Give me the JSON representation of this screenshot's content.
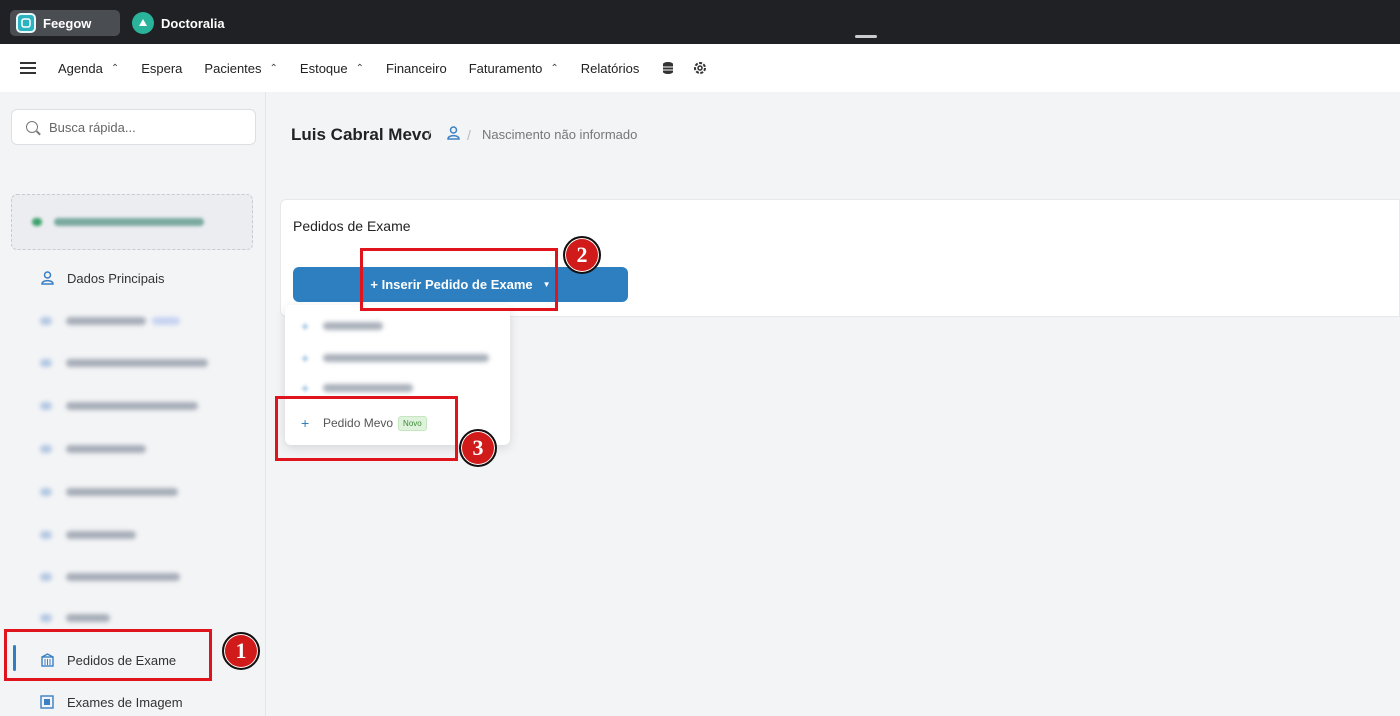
{
  "tabs": [
    {
      "label": "Feegow"
    },
    {
      "label": "Doctoralia"
    }
  ],
  "nav": {
    "items": [
      {
        "label": "Agenda",
        "has_dropdown": true
      },
      {
        "label": "Espera",
        "has_dropdown": false
      },
      {
        "label": "Pacientes",
        "has_dropdown": true
      },
      {
        "label": "Estoque",
        "has_dropdown": true
      },
      {
        "label": "Financeiro",
        "has_dropdown": false
      },
      {
        "label": "Faturamento",
        "has_dropdown": true
      },
      {
        "label": "Relatórios",
        "has_dropdown": false
      }
    ],
    "icons": [
      "menu-icon",
      "database-icon",
      "settings-icon"
    ]
  },
  "sidebar": {
    "search_placeholder": "Busca rápida...",
    "items": {
      "dados_principais": "Dados Principais",
      "pedidos_de_exame": "Pedidos de Exame",
      "exames_de_imagem": "Exames de Imagem"
    }
  },
  "patient": {
    "name": "Luis Cabral Mevo",
    "separator": "/",
    "birth": "Nascimento não informado"
  },
  "card": {
    "title": "Pedidos de Exame",
    "insert_button": "+ Inserir Pedido de Exame"
  },
  "dropdown": {
    "pedido_mevo": "Pedido Mevo",
    "novo_badge": "Novo"
  },
  "annotations": [
    "1",
    "2",
    "3"
  ],
  "colors": {
    "accent": "#2d7fc0",
    "annotation_red": "#e0141c",
    "topbar": "#202124"
  }
}
